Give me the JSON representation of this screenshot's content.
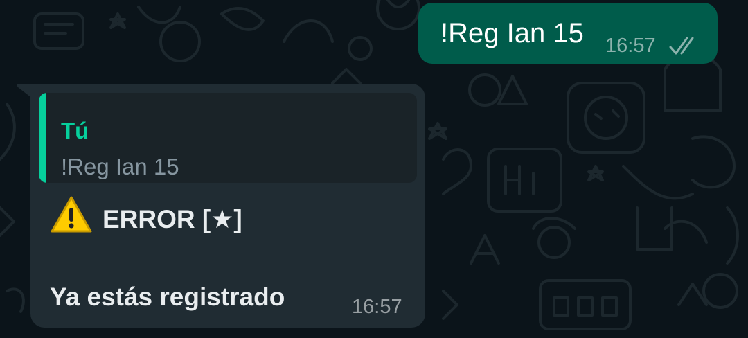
{
  "outgoing_message": {
    "text": "!Reg Ian 15",
    "time": "16:57",
    "status_icon": "double-check-icon"
  },
  "incoming_message": {
    "quoted": {
      "author": "Tú",
      "text": "!Reg Ian 15"
    },
    "warning_icon": "warning-icon",
    "title": "ERROR [★]",
    "body": "Ya estás registrado",
    "time": "16:57"
  },
  "colors": {
    "background": "#0b141a",
    "outgoing_bubble": "#005c4b",
    "incoming_bubble": "#202c33",
    "quote_accent": "#06cf9c",
    "warning_yellow": "#ffcc00"
  }
}
